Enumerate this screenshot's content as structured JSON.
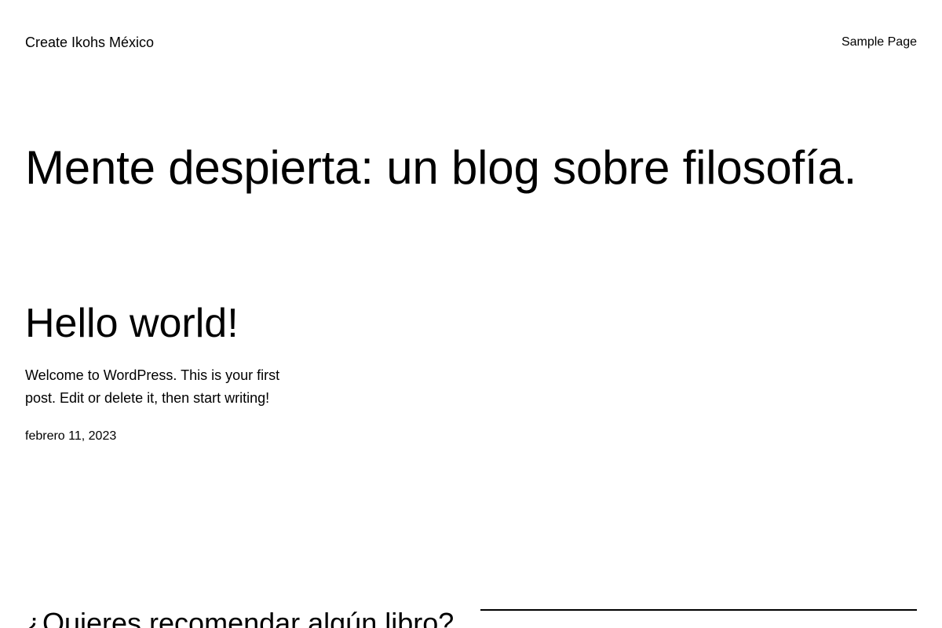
{
  "header": {
    "site_title": "Create Ikohs México",
    "nav": [
      {
        "label": "Sample Page"
      }
    ]
  },
  "hero": {
    "title": "Mente despierta: un blog sobre filosofía."
  },
  "posts": [
    {
      "title": "Hello world!",
      "excerpt": "Welcome to WordPress. This is your first post. Edit or delete it, then start writing!",
      "date": "febrero 11, 2023"
    }
  ],
  "cta": {
    "title": "¿Quieres recomendar algún libro?"
  }
}
